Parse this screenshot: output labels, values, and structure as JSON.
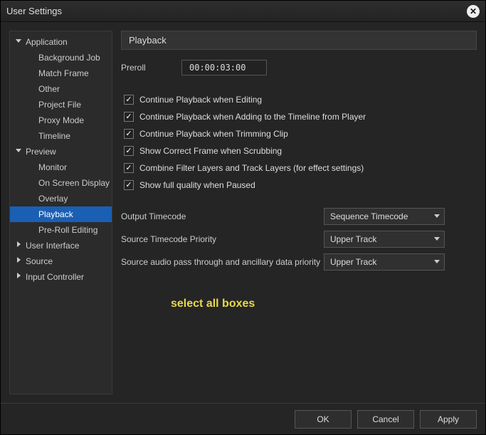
{
  "window": {
    "title": "User Settings"
  },
  "sidebar": {
    "sections": [
      {
        "label": "Application",
        "expanded": true,
        "items": [
          {
            "label": "Background Job"
          },
          {
            "label": "Match Frame"
          },
          {
            "label": "Other"
          },
          {
            "label": "Project File"
          },
          {
            "label": "Proxy Mode"
          },
          {
            "label": "Timeline"
          }
        ]
      },
      {
        "label": "Preview",
        "expanded": true,
        "items": [
          {
            "label": "Monitor"
          },
          {
            "label": "On Screen Display"
          },
          {
            "label": "Overlay"
          },
          {
            "label": "Playback",
            "selected": true
          },
          {
            "label": "Pre-Roll Editing"
          }
        ]
      },
      {
        "label": "User Interface",
        "expanded": false,
        "items": []
      },
      {
        "label": "Source",
        "expanded": false,
        "items": []
      },
      {
        "label": "Input Controller",
        "expanded": false,
        "items": []
      }
    ]
  },
  "panel": {
    "title": "Playback",
    "preroll_label": "Preroll",
    "preroll_value": "00:00:03:00",
    "checks": [
      {
        "label": "Continue Playback when Editing",
        "checked": true
      },
      {
        "label": "Continue Playback when Adding to the Timeline from Player",
        "checked": true
      },
      {
        "label": "Continue Playback when Trimming Clip",
        "checked": true
      },
      {
        "label": "Show Correct Frame when Scrubbing",
        "checked": true
      },
      {
        "label": "Combine Filter Layers and Track Layers (for effect settings)",
        "checked": true
      },
      {
        "label": "Show full quality when Paused",
        "checked": true
      }
    ],
    "selects": [
      {
        "label": "Output Timecode",
        "value": "Sequence Timecode"
      },
      {
        "label": "Source Timecode Priority",
        "value": "Upper Track"
      },
      {
        "label": "Source audio pass through and ancillary data priority",
        "value": "Upper Track"
      }
    ],
    "annotation": "select all boxes"
  },
  "footer": {
    "ok": "OK",
    "cancel": "Cancel",
    "apply": "Apply"
  }
}
